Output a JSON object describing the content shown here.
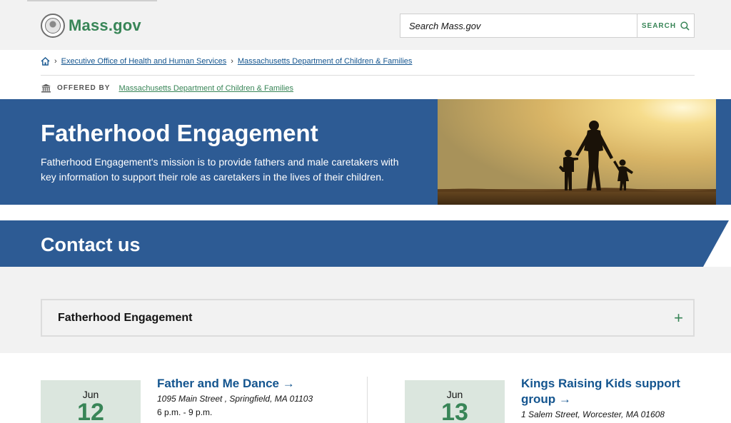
{
  "header": {
    "logo_text": "Mass.gov",
    "search_placeholder": "Search Mass.gov",
    "search_button": "SEARCH",
    "search_icon": "magnifier-icon",
    "seal_icon": "massachusetts-seal-icon"
  },
  "breadcrumb": {
    "home_icon": "home-icon",
    "items": [
      "Executive Office of Health and Human Services",
      "Massachusetts Department of Children & Families"
    ]
  },
  "offered_by": {
    "icon": "building-icon",
    "label": "OFFERED BY",
    "link": "Massachusetts Department of Children & Families"
  },
  "hero": {
    "title": "Fatherhood Engagement",
    "description": "Fatherhood Engagement's mission is to provide fathers and male caretakers with key information to support their role as caretakers in the lives of their children."
  },
  "contact": {
    "heading": "Contact us",
    "accordion_title": "Fatherhood Engagement",
    "expand_icon": "plus-icon"
  },
  "events": [
    {
      "month": "Jun",
      "day": "12",
      "title": "Father and Me Dance →",
      "address": "1095 Main Street , Springfield, MA 01103",
      "time": "6 p.m. - 9 p.m."
    },
    {
      "month": "Jun",
      "day": "13",
      "title_line1": "Kings Raising Kids support",
      "title_line2": "group →",
      "address": "1 Salem Street, Worcester, MA 01608"
    }
  ],
  "colors": {
    "brand_green": "#388557",
    "brand_blue": "#2d5b94",
    "link_blue": "#14558f",
    "gray_bg": "#f2f2f2"
  }
}
